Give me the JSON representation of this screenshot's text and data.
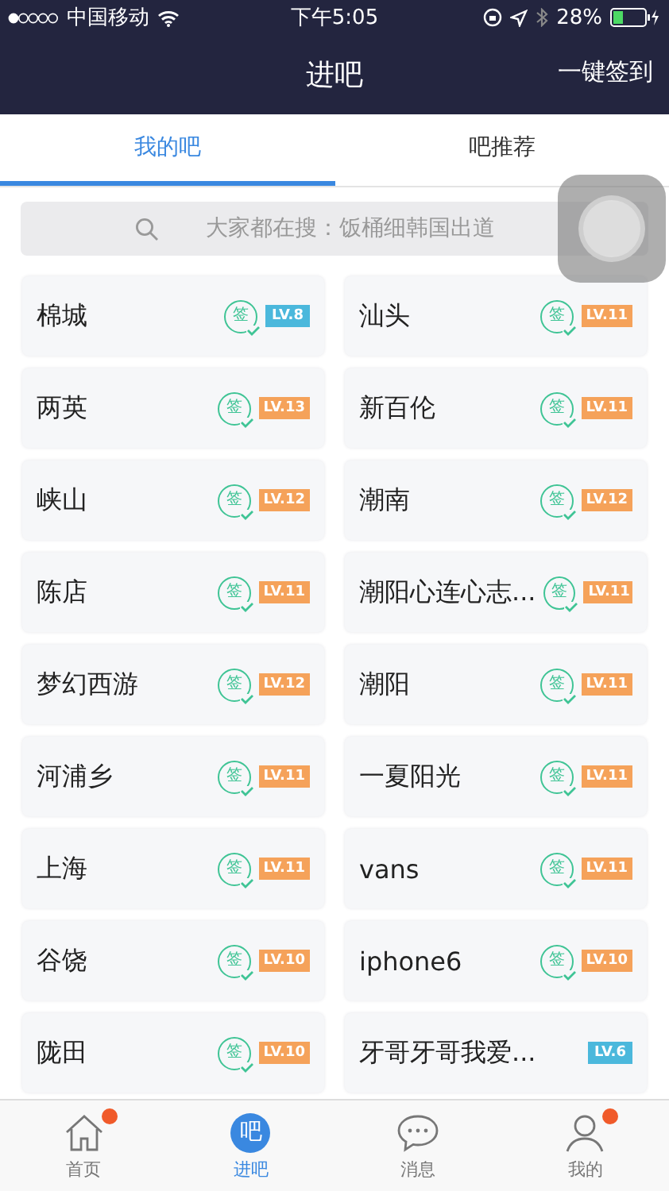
{
  "status_bar": {
    "carrier": "中国移动",
    "time": "下午5:05",
    "battery": "28%"
  },
  "nav": {
    "title": "进吧",
    "action": "一键签到"
  },
  "tabs": [
    {
      "label": "我的吧",
      "selected": true
    },
    {
      "label": "吧推荐",
      "selected": false
    }
  ],
  "search": {
    "placeholder": "大家都在搜：饭桶细韩国出道"
  },
  "forums": [
    {
      "name": "棉城",
      "sign_label": "签",
      "level_label": "LV.8",
      "color": "#4bb8dc"
    },
    {
      "name": "汕头",
      "sign_label": "签",
      "level_label": "LV.11",
      "color": "#f5a25a"
    },
    {
      "name": "两英",
      "sign_label": "签",
      "level_label": "LV.13",
      "color": "#f5a25a"
    },
    {
      "name": "新百伦",
      "sign_label": "签",
      "level_label": "LV.11",
      "color": "#f5a25a"
    },
    {
      "name": "峡山",
      "sign_label": "签",
      "level_label": "LV.12",
      "color": "#f5a25a"
    },
    {
      "name": "潮南",
      "sign_label": "签",
      "level_label": "LV.12",
      "color": "#f5a25a"
    },
    {
      "name": "陈店",
      "sign_label": "签",
      "level_label": "LV.11",
      "color": "#f5a25a"
    },
    {
      "name": "潮阳心连心志...",
      "sign_label": "签",
      "level_label": "LV.11",
      "color": "#f5a25a"
    },
    {
      "name": "梦幻西游",
      "sign_label": "签",
      "level_label": "LV.12",
      "color": "#f5a25a"
    },
    {
      "name": "潮阳",
      "sign_label": "签",
      "level_label": "LV.11",
      "color": "#f5a25a"
    },
    {
      "name": "河浦乡",
      "sign_label": "签",
      "level_label": "LV.11",
      "color": "#f5a25a"
    },
    {
      "name": "一夏阳光",
      "sign_label": "签",
      "level_label": "LV.11",
      "color": "#f5a25a"
    },
    {
      "name": "上海",
      "sign_label": "签",
      "level_label": "LV.11",
      "color": "#f5a25a"
    },
    {
      "name": "vans",
      "sign_label": "签",
      "level_label": "LV.11",
      "color": "#f5a25a"
    },
    {
      "name": "谷饶",
      "sign_label": "签",
      "level_label": "LV.10",
      "color": "#f5a25a"
    },
    {
      "name": "iphone6",
      "sign_label": "签",
      "level_label": "LV.10",
      "color": "#f5a25a"
    },
    {
      "name": "陇田",
      "sign_label": "签",
      "level_label": "LV.10",
      "color": "#f5a25a"
    },
    {
      "name": "牙哥牙哥我爱...",
      "level_label": "LV.6",
      "color": "#4bb8dc"
    }
  ],
  "tab_bar": [
    {
      "kind": "home",
      "label": "首页",
      "selected": false,
      "badge": true
    },
    {
      "kind": "forum",
      "label": "进吧",
      "glyph": "吧",
      "selected": true,
      "badge": false
    },
    {
      "kind": "message",
      "label": "消息",
      "selected": false,
      "badge": false
    },
    {
      "kind": "profile",
      "label": "我的",
      "selected": false,
      "badge": true
    }
  ]
}
